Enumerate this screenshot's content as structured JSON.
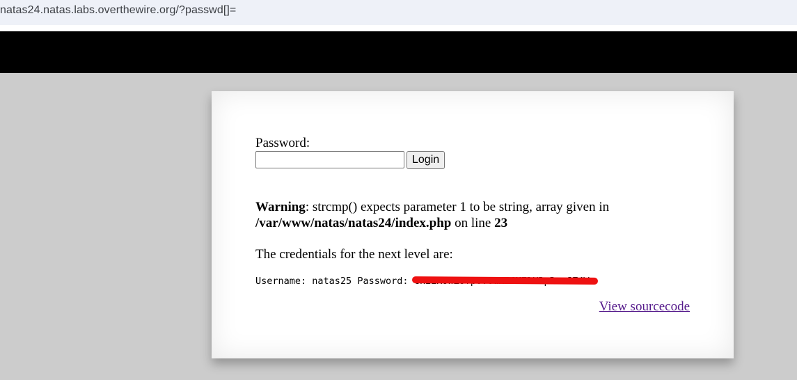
{
  "browser": {
    "url": "natas24.natas.labs.overthewire.org/?passwd[]="
  },
  "form": {
    "password_label": "Password:",
    "password_value": "",
    "login_label": "Login"
  },
  "warning": {
    "prefix": "Warning",
    "message": ": strcmp() expects parameter 1 to be string, array given in",
    "file": "/var/www/natas/natas24/index.php",
    "on_line_text": " on line ",
    "line_number": "23"
  },
  "credentials": {
    "intro": "The credentials for the next level are:",
    "username_label": "Username: ",
    "username": "natas25",
    "password_label": " Password: ",
    "password": "ckELKUWZUfpOv6uxS6M7lXBpBssJZ4Ws"
  },
  "links": {
    "view_source": "View sourcecode"
  },
  "colors": {
    "page_background": "#cccccc",
    "banner": "#000000",
    "link_visited": "#551a8b",
    "redaction": "#ee1111"
  }
}
